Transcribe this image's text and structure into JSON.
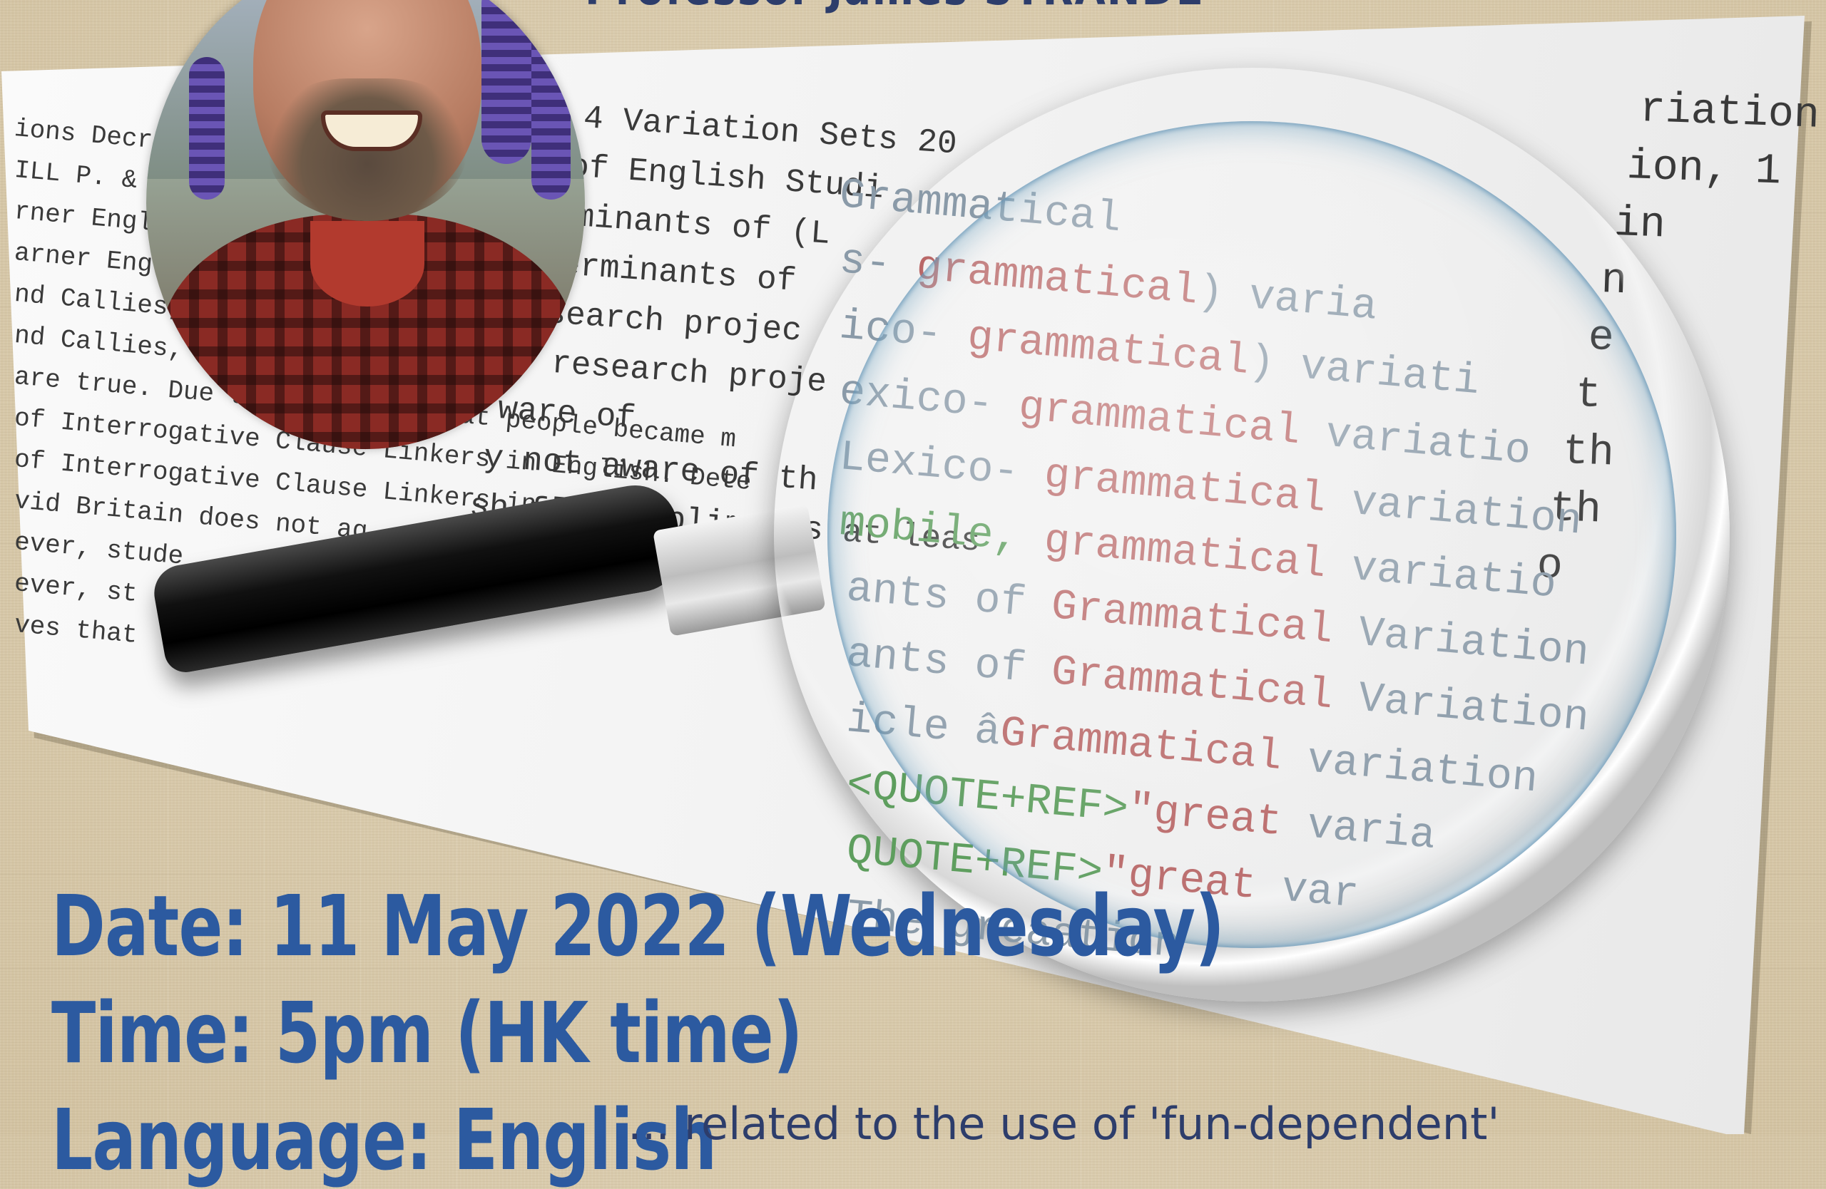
{
  "header": {
    "speaker_line": "Professor James STRANDE"
  },
  "background_document": {
    "left_lines": [
      "ions Decrea",
      "ILL P. & J.",
      "rner Englis",
      "arner Englis",
      "nd Callies, st",
      "nd Callies, sta",
      "are true. Due to the fact, that people became m",
      "of Interrogative Clause Linkers in English. Dete",
      "of Interrogative Clause Linkers in E",
      "vid Britain does not ag",
      "ever, stude",
      "ever, st",
      "ves that"
    ],
    "middle_lines": [
      "4 Variation Sets  20",
      "of English Studi",
      "rminants of (L",
      "terminants of",
      "esearch projec",
      "e research proje",
      "ware of",
      "y not aware of th",
      "sh for compliments at leas"
    ],
    "right_lines": [
      "riation Se",
      "ion, 1",
      "in",
      "n",
      "e",
      "t",
      "th",
      "th",
      "o"
    ]
  },
  "magnified_text": [
    {
      "a": "Grammatical",
      "b": "",
      "c": ""
    },
    {
      "a": "s- ",
      "b": "grammatical",
      "c": ") varia"
    },
    {
      "a": "ico- ",
      "b": "grammatical",
      "c": ") variati"
    },
    {
      "a": "exico- ",
      "b": "grammatical",
      "c": " variatio"
    },
    {
      "a": "Lexico- ",
      "b": "grammatical",
      "c": " variation"
    },
    {
      "a": "mobile, ",
      "b": "grammatical",
      "c": " variatio"
    },
    {
      "a": "ants of ",
      "b": "Grammatical",
      "c": " Variation"
    },
    {
      "a": "ants of ",
      "b": "Grammatical",
      "c": " Variation"
    },
    {
      "a": "icle â",
      "b": "Grammatical",
      "c": " variation"
    },
    {
      "a": "<QUOTE+REF>",
      "b": "\"great",
      "c": " varia"
    },
    {
      "a": "QUOTE+REF>",
      "b": "\"great",
      "c": " var"
    },
    {
      "a": "The grea",
      "b": "",
      "c": "ation"
    }
  ],
  "event": {
    "date": "Date: 11 May 2022 (Wednesday)",
    "time": "Time: 5pm (HK time)",
    "language": "Language: English"
  },
  "bottom_note": "... related to the use of 'fun-dependent'",
  "colors": {
    "accent_blue": "#2c5aa0",
    "background": "#d8c9ab",
    "green_text": "#5b9a5b",
    "red_text": "#b86a6a"
  },
  "icons": [
    "magnifying-glass-icon"
  ]
}
